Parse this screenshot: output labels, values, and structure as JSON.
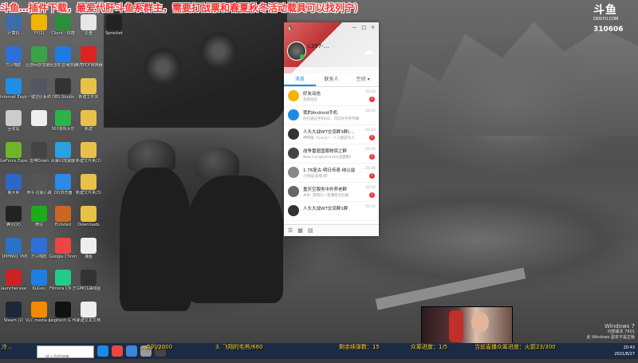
{
  "banner": {
    "text": "斗鱼…插件下载，最爱代肝斗鱼系群主，需要打战票和春夏秋冬活动载具可以找列宁）"
  },
  "logo": {
    "brand": "斗鱼",
    "sub": "DOUYU.COM",
    "room": "310606"
  },
  "desktop_icons": [
    {
      "label": "计算机",
      "color": "#3b6ea5"
    },
    {
      "label": "YY(2)",
      "color": "#f0b400"
    },
    {
      "label": "Client - 快捷",
      "color": "#2a8f3a"
    },
    {
      "label": "云盘",
      "color": "#e7e7e7"
    },
    {
      "label": "Sprocket",
      "color": "#222"
    },
    {
      "label": "万兴喵影",
      "color": "#2d6fd6"
    },
    {
      "label": "迅游网游加速器",
      "color": "#3aa34a"
    },
    {
      "label": "迅雷影音播放器",
      "color": "#1f7be3"
    },
    {
      "label": "翼虎PDF转换器",
      "color": "#d22"
    },
    {
      "label": "Internet Explorer",
      "color": "#1e8ee8"
    },
    {
      "label": "一键还原系统",
      "color": "#556"
    },
    {
      "label": "OBS Studio",
      "color": "#333"
    },
    {
      "label": "新建文件夹",
      "color": "#e7c24a"
    },
    {
      "label": "回收站",
      "color": "#ccc"
    },
    {
      "label": "",
      "color": "#eee"
    },
    {
      "label": "360游戏大厅",
      "color": "#2db34a"
    },
    {
      "label": "新建",
      "color": "#e7c24a"
    },
    {
      "label": "GeForce Experience",
      "color": "#6fb52c"
    },
    {
      "label": "雷神Down",
      "color": "#444"
    },
    {
      "label": "风暴UI加速器",
      "color": "#2aa1e0"
    },
    {
      "label": "新建文件夹(2)",
      "color": "#e7c24a"
    },
    {
      "label": "鲁大师",
      "color": "#2b68c7"
    },
    {
      "label": "命令·征服心跳",
      "color": "#555"
    },
    {
      "label": "QQ浏览器",
      "color": "#2d8ae6"
    },
    {
      "label": "新建文件夹(3)",
      "color": "#e7c24a"
    },
    {
      "label": "腾讯QQ",
      "color": "#222"
    },
    {
      "label": "微信",
      "color": "#1aad19"
    },
    {
      "label": "Enlisted",
      "color": "#c62"
    },
    {
      "label": "Downloads",
      "color": "#e7c24a"
    },
    {
      "label": "【MHNV】所有加速器",
      "color": "#2a72c9"
    },
    {
      "label": "万兴喵影",
      "color": "#2d6fd6"
    },
    {
      "label": "Google Chrome",
      "color": "#e44"
    },
    {
      "label": "捕鱼",
      "color": "#eee"
    },
    {
      "label": "launcher.exe",
      "color": "#c22"
    },
    {
      "label": "KuGou",
      "color": "#1e7fe0"
    },
    {
      "label": "Filmora CN 万兴喵影",
      "color": "#2c8"
    },
    {
      "label": "GMO1曲线图",
      "color": "#333"
    },
    {
      "label": "Steam (2)",
      "color": "#1b2838"
    },
    {
      "label": "VLC media player",
      "color": "#f38a00"
    },
    {
      "label": "Logitech G HUB",
      "color": "#111"
    },
    {
      "label": "新建文本文档",
      "color": "#eee"
    }
  ],
  "qq": {
    "window_controls": "— □ ×",
    "nickname": "L397-…",
    "tabs": [
      "消息",
      "联系人",
      "空间 ▾"
    ],
    "active_tab": 0,
    "items": [
      {
        "name": "好友动态",
        "preview": "有新动态",
        "time": "20:43",
        "badge": "1",
        "color": "#f5b400"
      },
      {
        "name": "我的Android手机",
        "preview": "你已通过手机QQ，可向文件夹传输",
        "time": "20:41",
        "badge": "",
        "color": "#1a8ae6"
      },
      {
        "name": "人头大战WT交流群3群(…",
        "preview": "神鸭菌（Curry）: 人人都是鸟人",
        "time": "20:43",
        "badge": "1",
        "color": "#333"
      },
      {
        "name": "战争雷霆国服物资之群",
        "preview": "New Conglomerate(战雷群)",
        "time": "20:41",
        "badge": "1",
        "color": "#444"
      },
      {
        "name": "1.76复古·明日传奇·纯公益",
        "preview": "小师陪[表情]宗",
        "time": "20:38",
        "badge": "1",
        "color": "#888"
      },
      {
        "name": "重庆空服务中外养老群",
        "preview": "水水: 游戏力一帮谦性对云路",
        "time": "20:32",
        "badge": "1",
        "color": "#666"
      },
      {
        "name": "人头大战WT交流群1群",
        "preview": "",
        "time": "20:32",
        "badge": "",
        "color": "#333"
      }
    ]
  },
  "taskbar": {
    "search_placeholder": "输入你想搜索",
    "apps": [
      {
        "name": "qq-taskbar",
        "color": "#1a8ae6"
      },
      {
        "name": "chrome-taskbar",
        "color": "#e44"
      },
      {
        "name": "arrow-taskbar",
        "color": "#3b86d8"
      },
      {
        "name": "game-taskbar",
        "color": "#999"
      },
      {
        "name": "obs-taskbar",
        "color": "#444"
      }
    ],
    "clock_time": "20:43",
    "clock_date": "2021/8/27"
  },
  "ticker": [
    "3. 飞翔的毛熊/660",
    "剩余续弹数：15",
    "众筹进度：1/5",
    "当前直播众筹进度：火箭23/300",
    "…点列/2000",
    "冷..."
  ],
  "watermark": {
    "line1": "Windows 7",
    "line2": "内部版本 7601",
    "line3": "此 Windows 副本不是正版"
  }
}
